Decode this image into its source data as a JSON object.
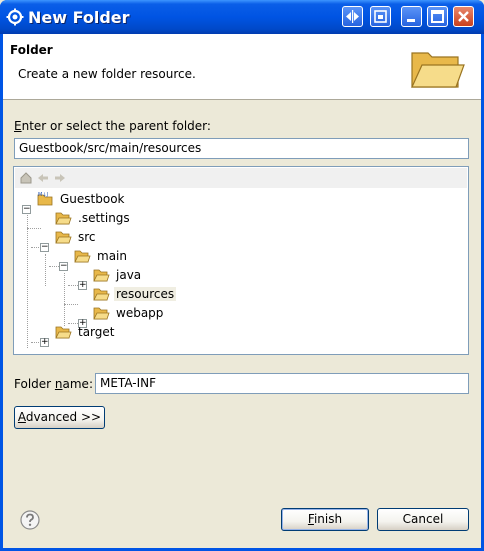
{
  "window": {
    "title": "New Folder"
  },
  "header": {
    "title": "Folder",
    "description": "Create a new folder resource."
  },
  "parent": {
    "label_prefix": "E",
    "label_rest": "nter or select the parent folder:",
    "value": "Guestbook/src/main/resources"
  },
  "tree": {
    "items": [
      {
        "label": "Guestbook",
        "badge": "M↓J"
      },
      {
        "label": ".settings"
      },
      {
        "label": "src"
      },
      {
        "label": "main"
      },
      {
        "label": "java"
      },
      {
        "label": "resources",
        "selected": true
      },
      {
        "label": "webapp"
      },
      {
        "label": "target"
      }
    ]
  },
  "folder_name": {
    "label_pre": "Folder ",
    "label_ul": "n",
    "label_post": "ame:",
    "value": "META-INF"
  },
  "advanced": {
    "label_ul": "A",
    "label_rest": "dvanced >>"
  },
  "buttons": {
    "finish_ul": "F",
    "finish_rest": "inish",
    "cancel": "Cancel"
  },
  "colors": {
    "titlebar": "#0054e3",
    "accent": "#003c74",
    "selection": "#f0eee2"
  }
}
